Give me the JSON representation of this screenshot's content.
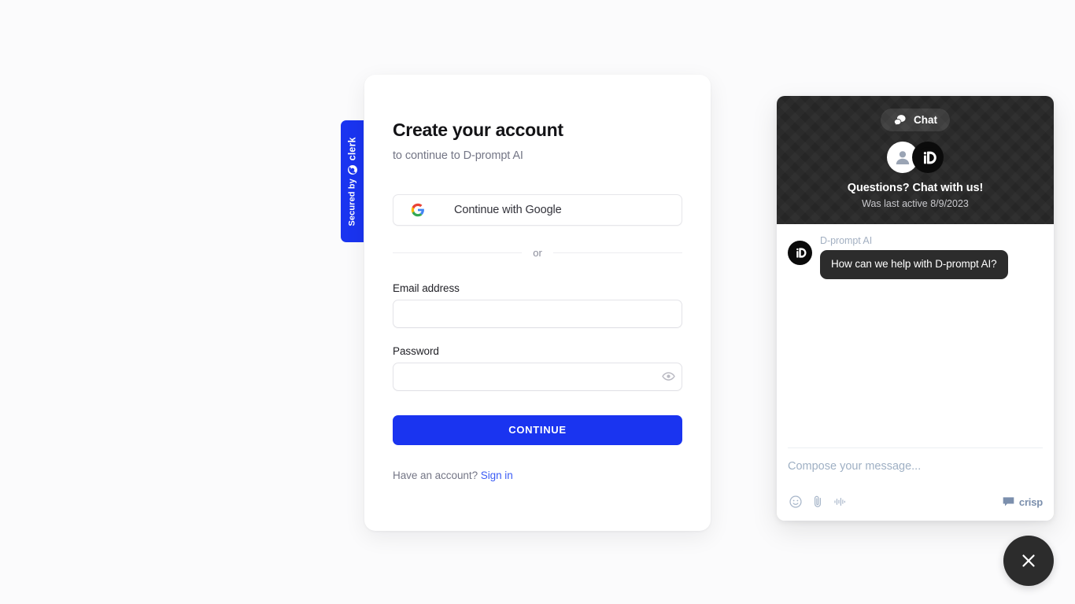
{
  "signup": {
    "title": "Create your account",
    "subtitle": "to continue to D-prompt AI",
    "google_button_label": "Continue with Google",
    "google_icon": "google-g-icon",
    "divider_label": "or",
    "email_label": "Email address",
    "email_value": "",
    "email_placeholder": "",
    "password_label": "Password",
    "password_value": "",
    "password_placeholder": "",
    "password_toggle_icon": "eye-icon",
    "continue_label": "CONTINUE",
    "have_account_text": "Have an account?",
    "sign_in_label": "Sign in",
    "primary_color": "#1a34f0",
    "link_color": "#3b5cf5"
  },
  "clerk_badge": {
    "secured_by_label": "Secured by",
    "brand_label": "clerk",
    "icon": "clerk-logo-icon",
    "background_color": "#1a34f0"
  },
  "chat": {
    "pill_label": "Chat",
    "pill_icon": "chat-bubbles-icon",
    "visitor_avatar_icon": "user-avatar-icon",
    "operator_avatar_icon": "d-prompt-logo-icon",
    "heading": "Questions? Chat with us!",
    "subheading": "Was last active 8/9/2023",
    "messages": [
      {
        "sender": "D-prompt AI",
        "text": "How can we help with D-prompt AI?",
        "avatar_icon": "d-prompt-logo-icon"
      }
    ],
    "compose_value": "",
    "compose_placeholder": "Compose your message...",
    "tools": [
      {
        "icon": "emoji-smiley-icon"
      },
      {
        "icon": "paperclip-attachment-icon"
      },
      {
        "icon": "audio-waveform-icon"
      }
    ],
    "branding_label": "crisp",
    "branding_icon": "crisp-bubble-icon",
    "header_background_color": "#262626",
    "bubble_background_color": "#2c2c2c"
  },
  "launcher": {
    "close_icon": "close-x-icon",
    "background_color": "#2c2c2c"
  }
}
